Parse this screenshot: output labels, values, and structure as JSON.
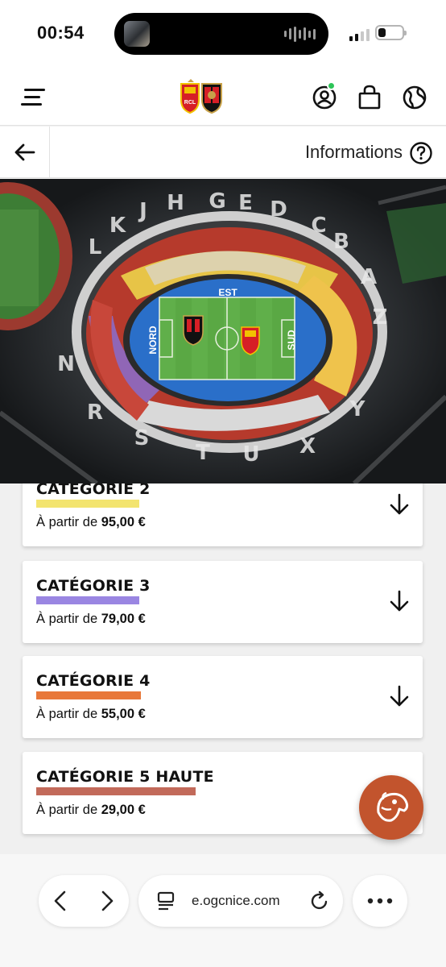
{
  "status_bar": {
    "time": "00:54"
  },
  "header": {
    "online_color": "#2ec458"
  },
  "subheader": {
    "info_label": "Informations"
  },
  "stadium": {
    "stand_letters": [
      "L",
      "K",
      "J",
      "H",
      "G",
      "E",
      "D",
      "C",
      "B",
      "A",
      "Z",
      "N",
      "R",
      "S",
      "T",
      "U",
      "X",
      "Y"
    ],
    "stands": {
      "east": "EST",
      "north": "NORD",
      "south": "SUD"
    }
  },
  "categories": [
    {
      "name": "CATÉGORIE 2",
      "price_prefix": "À partir de ",
      "price": "95,00 €",
      "color": "#f3e46f"
    },
    {
      "name": "CATÉGORIE 3",
      "price_prefix": "À partir de ",
      "price": "79,00 €",
      "color": "#9a86e2"
    },
    {
      "name": "CATÉGORIE 4",
      "price_prefix": "À partir de ",
      "price": "55,00 €",
      "color": "#e8783a"
    },
    {
      "name": "CATÉGORIE 5 HAUTE",
      "price_prefix": "À partir de ",
      "price": "29,00 €",
      "color": "#c26a5a"
    }
  ],
  "browser": {
    "url": "e.ogcnice.com"
  }
}
